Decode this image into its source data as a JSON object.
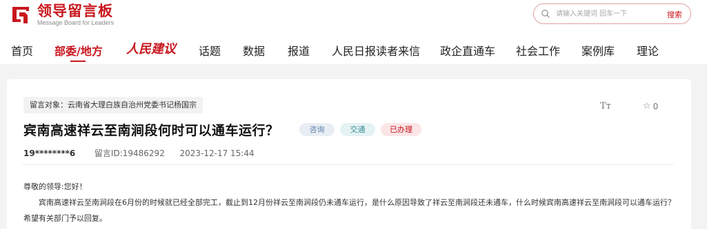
{
  "header": {
    "logo_title": "领导留言板",
    "logo_subtitle": "Message Board for Leaders",
    "search_placeholder": "请输入关键词 回车一下",
    "search_button": "搜索"
  },
  "nav": {
    "items": [
      {
        "label": "首页"
      },
      {
        "label": "部委/地方"
      },
      {
        "label": "人民建议"
      },
      {
        "label": "话题"
      },
      {
        "label": "数据"
      },
      {
        "label": "报道"
      },
      {
        "label": "人民日报读者来信"
      },
      {
        "label": "政企直通车"
      },
      {
        "label": "社会工作"
      },
      {
        "label": "案例库"
      },
      {
        "label": "理论"
      }
    ],
    "active_index": 1
  },
  "message": {
    "target": "留言对象：云南省大理白族自治州党委书记杨国宗",
    "font_tool": "Tт",
    "favorite_count": "0",
    "title": "宾南高速祥云至南涧段何时可以通车运行？",
    "tags": [
      "咨询",
      "交通",
      "已办理"
    ],
    "user": "19********6",
    "message_id": "留言ID:19486292",
    "datetime": "2023-12-17 15:44",
    "greeting": "尊敬的领导:您好！",
    "content": "宾南高速祥云至南涧段在6月份的时候就已经全部完工，截止到12月份祥云至南涧段仍未通车运行，是什么原因导致了祥云至南涧段还未通车，什么时候宾南高速祥云至南涧段可以通车运行？希望有关部门予以回复。"
  },
  "colors": {
    "brand_red": "#c8161d",
    "page_bg": "#f3f3f3"
  }
}
